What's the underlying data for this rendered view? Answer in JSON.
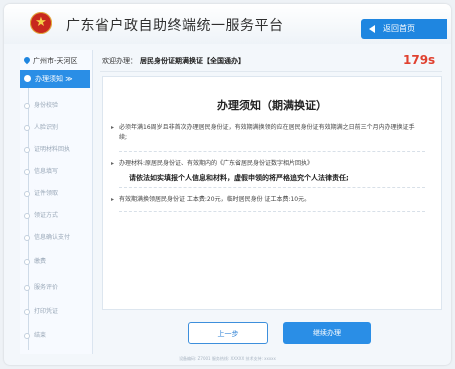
{
  "header": {
    "title": "广东省户政自助终端统一服务平台",
    "home_label": "返回首页"
  },
  "sidebar": {
    "location": "广州市-天河区",
    "active_step": "办理须知 ≫",
    "steps": [
      "身份校验",
      "人脸识别",
      "证明材料回执",
      "信息填写",
      "证件领取",
      "领证方式",
      "信息确认支付",
      "缴费",
      "服务评价",
      "打印凭证",
      "结束"
    ]
  },
  "main": {
    "welcome_prefix": "欢迎办理：",
    "service_name": "居民身份证期满换证【全国通办】",
    "countdown": "179s",
    "notice_title": "办理须知（期满换证）",
    "paragraphs": [
      "必须年满16周岁且非首次办理居民身份证，有效期满换领的应在居民身份证有效期满之日前三个月内办理换证手续;",
      "办理材料:原居民身份证、有效期内的《广东省居民身份证数字相片回执》",
      "有效期满换领居民身份证 工本费:20元，临时居民身份 证工本费:10元。"
    ],
    "warning": "请依法如实填报个人信息和材料，虚假申领的将严格追究个人法律责任;"
  },
  "buttons": {
    "prev_label": "上一步",
    "next_label": "继续办理"
  },
  "footer": {
    "text": "设备编码: Z7001   服务热线: XXXXX   技术支持: xxxxx"
  }
}
